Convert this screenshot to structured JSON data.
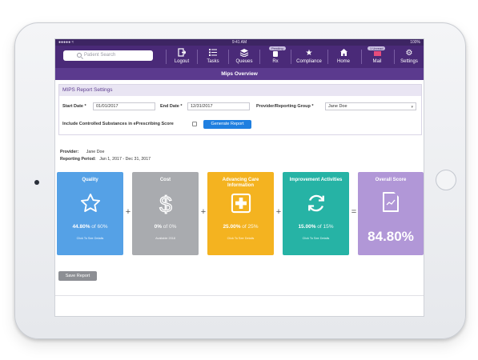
{
  "status": {
    "carrier": "●●●●● ≈",
    "time": "9:41 AM",
    "battery": "100%"
  },
  "search": {
    "placeholder": "Patient Search"
  },
  "nav": {
    "logout": "Logout",
    "tasks": "Tasks",
    "queues": "Queues",
    "rx": "Rx",
    "rx_badge": "Pending",
    "compliance": "Compliance",
    "home": "Home",
    "mail": "Mail",
    "mail_badge": "1 Unread",
    "settings": "Settings"
  },
  "page": {
    "title": "Mips Overview"
  },
  "settings": {
    "heading": "MIPS Report Settings",
    "start_label": "Start Date *",
    "start_value": "01/01/2017",
    "end_label": "End Date *",
    "end_value": "12/31/2017",
    "group_label": "Provider/Reporting Group *",
    "group_value": "Jane Doe",
    "controlled_label": "Include Controlled Substances in ePrescribing Score",
    "generate": "Generate Report"
  },
  "report": {
    "provider_label": "Provider:",
    "provider_value": "Jane Doe",
    "period_label": "Reporting Period:",
    "period_value": "Jan 1, 2017 - Dec 31, 2017"
  },
  "cards": {
    "quality": {
      "title": "Quality",
      "score": "44.80%",
      "of": "of 60%",
      "link": "Click To See Details"
    },
    "cost": {
      "title": "Cost",
      "score": "0%",
      "of": "of 0%",
      "link": "Available 2018"
    },
    "aci": {
      "title": "Advancing Care Information",
      "score": "25.00%",
      "of": "of 25%",
      "link": "Click To See Details"
    },
    "ia": {
      "title": "Improvement Activities",
      "score": "15.00%",
      "of": "of 15%",
      "link": "Click To See Details"
    },
    "overall": {
      "title": "Overall Score",
      "score": "84.80%"
    }
  },
  "operators": {
    "plus": "+",
    "equals": "="
  },
  "save": "Save Report"
}
